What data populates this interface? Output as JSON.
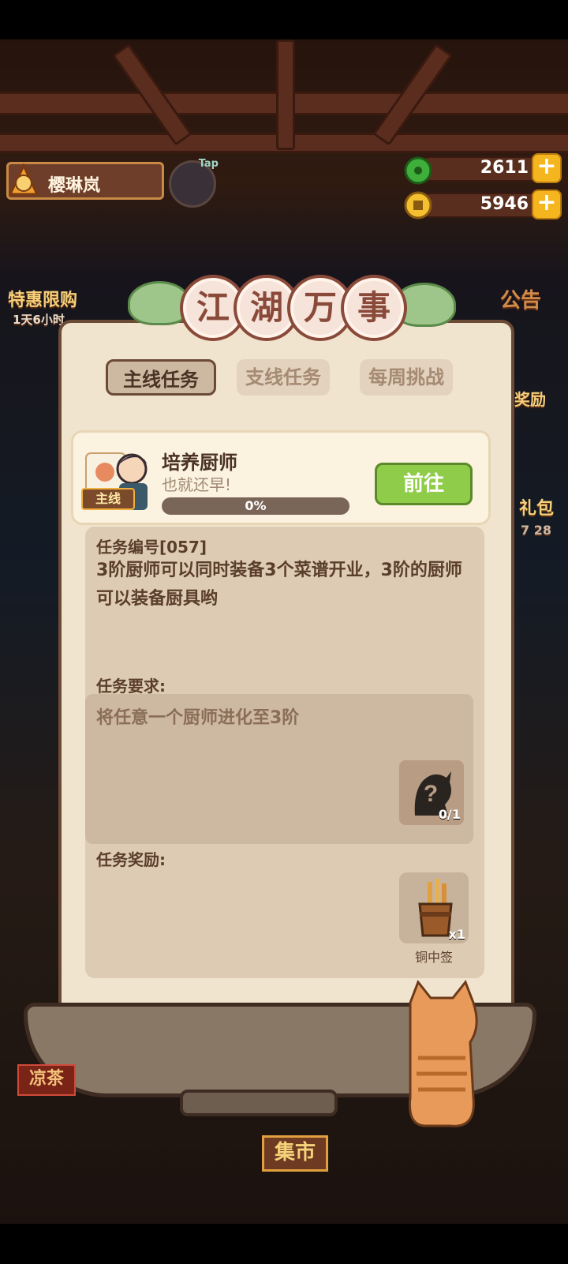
{
  "player": {
    "name": "樱琳岚",
    "tap_label": "Tap"
  },
  "currencies": [
    {
      "icon": "jade-coin-icon",
      "value": "2611"
    },
    {
      "icon": "gold-coin-icon",
      "value": "5946"
    }
  ],
  "side_labels": {
    "left_event": "特惠限购",
    "left_timer": "1天6小时",
    "right_notice": "公告",
    "right_reward": "奖励",
    "right_pack": "礼包",
    "right_count": "7 28"
  },
  "dialog": {
    "title_chars": [
      "江",
      "湖",
      "万",
      "事"
    ],
    "tabs": [
      {
        "label": "主线任务",
        "active": true
      },
      {
        "label": "支线任务",
        "active": false
      },
      {
        "label": "每周挑战",
        "active": false
      }
    ],
    "task": {
      "name": "培养厨师",
      "subtitle": "也就还早!",
      "tag": "主线",
      "progress_percent": 0,
      "progress_text": "0%",
      "go_label": "前往"
    },
    "task_number": "任务编号[057]",
    "description": "3阶厨师可以同时装备3个菜谱开业，3阶的厨师可以装备厨具哟",
    "requirement_label": "任务要求:",
    "requirement_text": "将任意一个厨师进化至3阶",
    "requirement_count": "0/1",
    "reward_label": "任务奖励:",
    "reward_name": "铜中签",
    "reward_count": "x1"
  },
  "scene": {
    "market_sign": "集市",
    "drink_sign": "凉茶"
  },
  "colors": {
    "accent_green": "#8fcc4a",
    "panel_bg": "#f1e4cf",
    "frame_brown": "#6b4a36"
  }
}
